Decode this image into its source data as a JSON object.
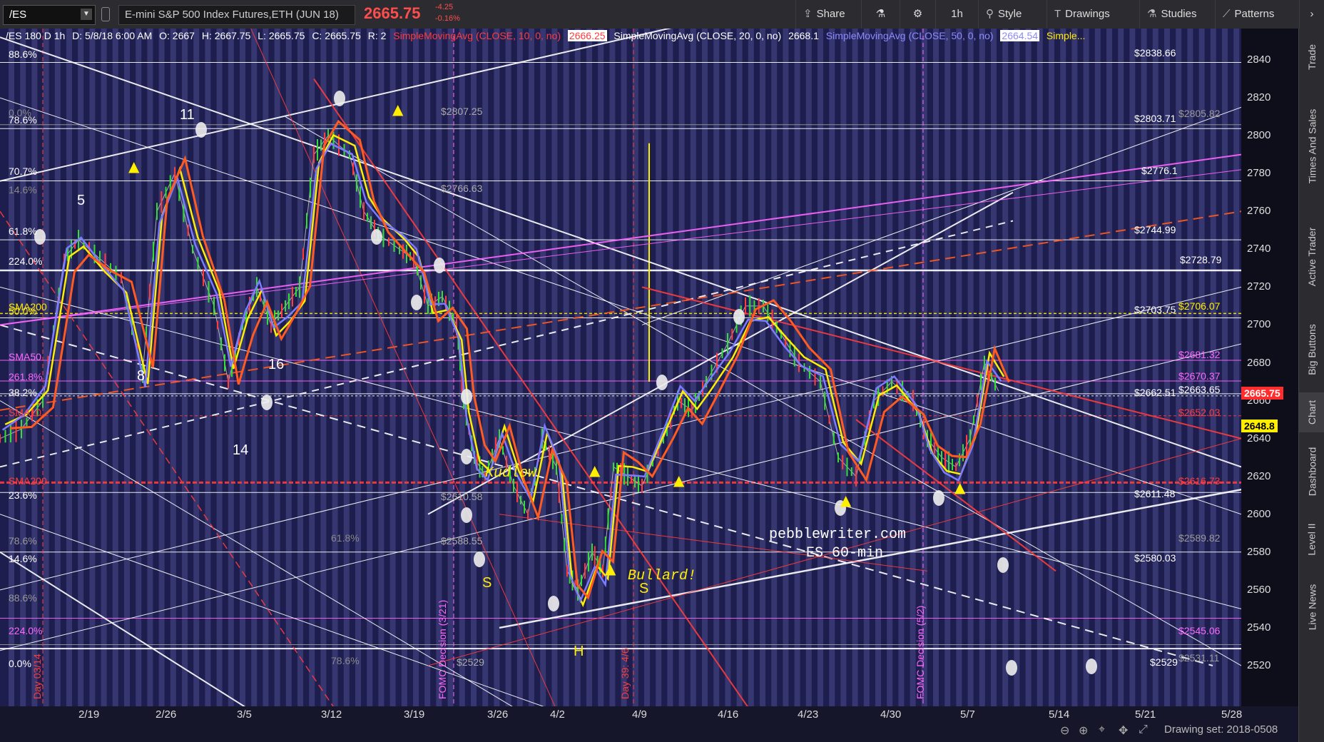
{
  "toolbar": {
    "symbol": "/ES",
    "description": "E-mini S&P 500 Index Futures,ETH (JUN 18)",
    "last_price": "2665.75",
    "change": "-4.25",
    "change_pct": "-0.16%",
    "share": "Share",
    "timeframe": "1h",
    "style": "Style",
    "drawings": "Drawings",
    "studies": "Studies",
    "patterns": "Patterns"
  },
  "infobar": {
    "label": "/ES 180 D 1h",
    "datetime": "D: 5/8/18 6:00 AM",
    "open": "O: 2667",
    "high": "H: 2667.75",
    "low": "L: 2665.75",
    "close": "C: 2665.75",
    "r": "R: 2",
    "sma10": "SimpleMovingAvg (CLOSE, 10, 0, no)",
    "sma10_val": "2666.25",
    "sma20": "SimpleMovingAvg (CLOSE, 20, 0, no)",
    "sma20_val": "2668.1",
    "sma50": "SimpleMovingAvg (CLOSE, 50, 0, no)",
    "sma50_val": "2664.54",
    "more": "Simple..."
  },
  "sidebar": [
    "Trade",
    "Times And Sales",
    "Active Trader",
    "Big Buttons",
    "Chart",
    "Dashboard",
    "Level II",
    "Live News"
  ],
  "yaxis": [
    "2840",
    "2820",
    "2800",
    "2780",
    "2760",
    "2740",
    "2720",
    "2700",
    "2680",
    "2660",
    "2640",
    "2620",
    "2600",
    "2580",
    "2560",
    "2540",
    "2520"
  ],
  "price_tags": {
    "current": "2665.75",
    "other": "2648.8"
  },
  "xaxis": [
    "2/19",
    "2/26",
    "3/5",
    "3/12",
    "3/19",
    "3/26",
    "4/2",
    "4/9",
    "4/16",
    "4/23",
    "4/30",
    "5/7",
    "5/14",
    "5/21",
    "5/28"
  ],
  "drawing_set": "Drawing set: 2018-0508",
  "fib_left": [
    "88.6%",
    "78.6%",
    "70.7%",
    "61.8%",
    "224.0%",
    "50.0%",
    "261.8%",
    "38.2%",
    "23.6%",
    "78.6%",
    "14.6%",
    "88.6%",
    "224.0%",
    "0.0%"
  ],
  "fib_faint": [
    "0.0%",
    "14.6%",
    "61.8%",
    "78.6%"
  ],
  "level_labels": [
    "$2838.66",
    "$2803.71",
    "$2776.1",
    "$2744.99",
    "$2728.79",
    "$2703.75",
    "$2662.51",
    "$2611.48",
    "$2580.03",
    "$2529"
  ],
  "level_labels_colored": {
    "2706": "$2706.07",
    "2681": "$2681.32",
    "2670": "$2670.37",
    "2663": "$2663.65",
    "2652": "$2652.03",
    "2616": "$2616.73",
    "2545": "$2545.06"
  },
  "level_labels_faint": [
    "$2805.82",
    "$2589.82",
    "$2531.11"
  ],
  "mid_faint": [
    "$2807.25",
    "$2766.63",
    "$2588.55",
    "$2529",
    "$2610.58"
  ],
  "sma_labels": [
    "SMA200",
    "SMA50",
    "SMA10",
    "SMA200"
  ],
  "annotations": {
    "kudlow": "Kudlow",
    "bullard": "Bullard!",
    "site": "pebblewriter.com",
    "timeframe_note": "ES 60-min",
    "s1": "S",
    "s2": "S",
    "h": "H",
    "fomc1": "FOMC Decision (3/21)",
    "fomc2": "FOMC Decision (5/2)",
    "day39": "Day 39: 4/6",
    "day": "Day 03/14"
  },
  "wave_numbers": [
    "11",
    "5",
    "8",
    "16",
    "14"
  ],
  "colors": {
    "bg": "#1e1e4e",
    "stripe": "#4a4a8e",
    "price_red": "#ff3b3b",
    "sma_yellow": "#ffee00",
    "sma_blue": "#7b7bff",
    "sma_orange": "#ff5a1f",
    "magenta": "#ff66ff"
  }
}
